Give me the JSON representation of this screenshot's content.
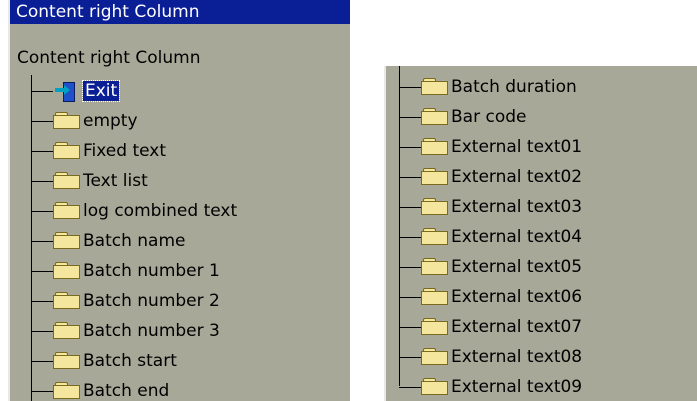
{
  "left": {
    "title": "Content right Column",
    "root_label": "Content right Column",
    "items": [
      {
        "label": "Exit",
        "icon": "exit-icon",
        "selected": true
      },
      {
        "label": "empty",
        "icon": "folder-icon"
      },
      {
        "label": "Fixed text",
        "icon": "folder-icon"
      },
      {
        "label": "Text list",
        "icon": "folder-icon"
      },
      {
        "label": "log combined text",
        "icon": "folder-icon"
      },
      {
        "label": "Batch name",
        "icon": "folder-icon"
      },
      {
        "label": "Batch number 1",
        "icon": "folder-icon"
      },
      {
        "label": "Batch number 2",
        "icon": "folder-icon"
      },
      {
        "label": "Batch number 3",
        "icon": "folder-icon"
      },
      {
        "label": "Batch start",
        "icon": "folder-icon"
      },
      {
        "label": "Batch end",
        "icon": "folder-icon"
      }
    ]
  },
  "right": {
    "items": [
      {
        "label": "Batch duration",
        "icon": "folder-icon"
      },
      {
        "label": "Bar code",
        "icon": "folder-icon"
      },
      {
        "label": "External text01",
        "icon": "folder-icon"
      },
      {
        "label": "External text02",
        "icon": "folder-icon"
      },
      {
        "label": "External text03",
        "icon": "folder-icon"
      },
      {
        "label": "External text04",
        "icon": "folder-icon"
      },
      {
        "label": "External text05",
        "icon": "folder-icon"
      },
      {
        "label": "External text06",
        "icon": "folder-icon"
      },
      {
        "label": "External text07",
        "icon": "folder-icon"
      },
      {
        "label": "External text08",
        "icon": "folder-icon"
      },
      {
        "label": "External text09",
        "icon": "folder-icon"
      }
    ]
  },
  "colors": {
    "panel_bg": "#a8a898",
    "selection_bg": "#0a1e96",
    "folder_fill": "#f4e69c"
  }
}
